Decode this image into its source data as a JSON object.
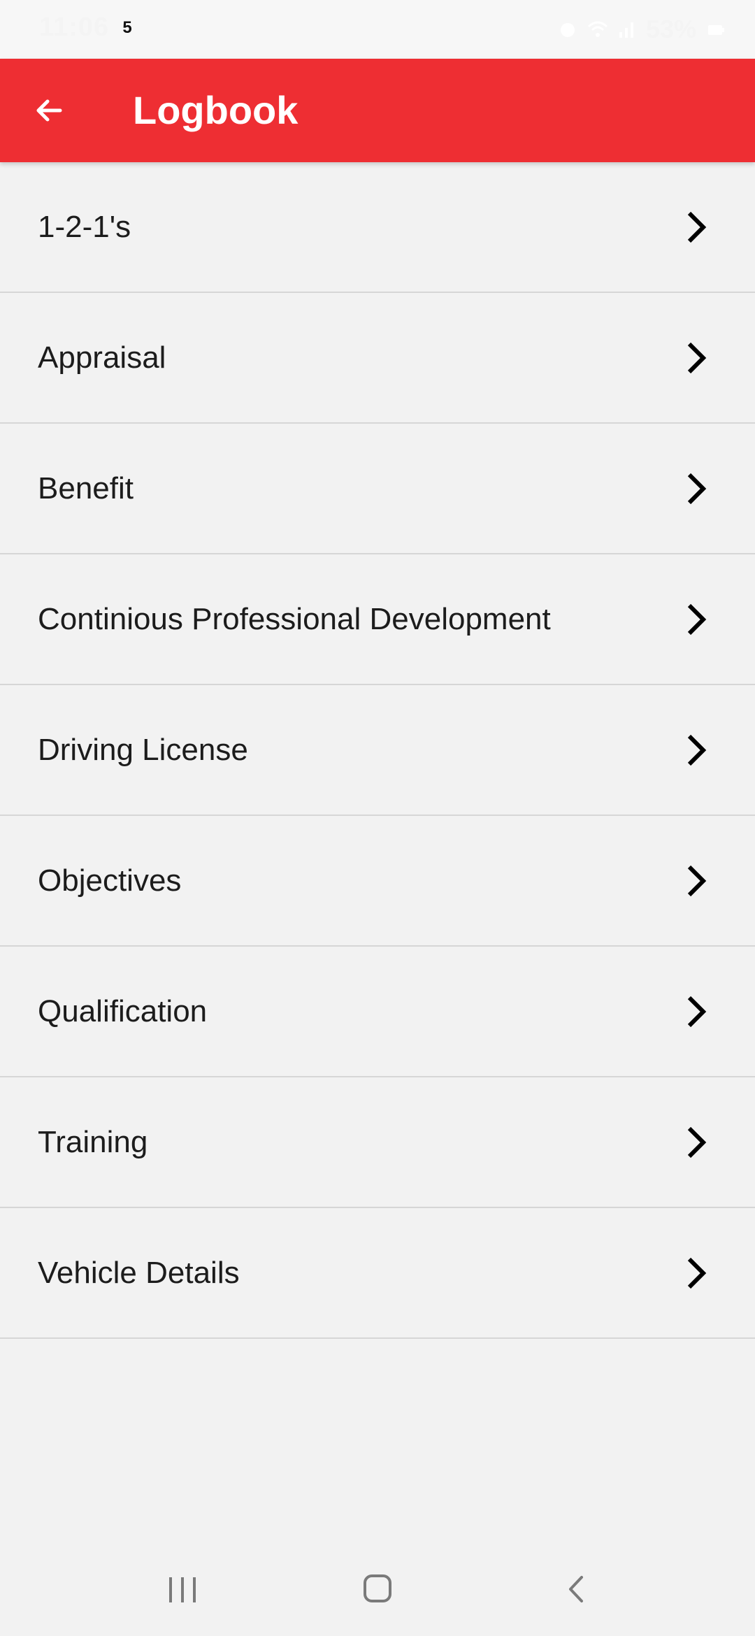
{
  "status_bar": {
    "time": "11:06",
    "notification_count": "5",
    "battery": "53%"
  },
  "app_bar": {
    "title": "Logbook",
    "color": "#ee2e33",
    "back_icon": "arrow-left-icon"
  },
  "list": {
    "items": [
      {
        "label": "1-2-1's"
      },
      {
        "label": "Appraisal"
      },
      {
        "label": "Benefit"
      },
      {
        "label": "Continious Professional Development"
      },
      {
        "label": "Driving License"
      },
      {
        "label": "Objectives"
      },
      {
        "label": "Qualification"
      },
      {
        "label": "Training"
      },
      {
        "label": "Vehicle Details"
      }
    ],
    "item_icon": "chevron-right-icon"
  },
  "nav_bar": {
    "icons": [
      "recents-icon",
      "home-icon",
      "back-icon"
    ]
  }
}
